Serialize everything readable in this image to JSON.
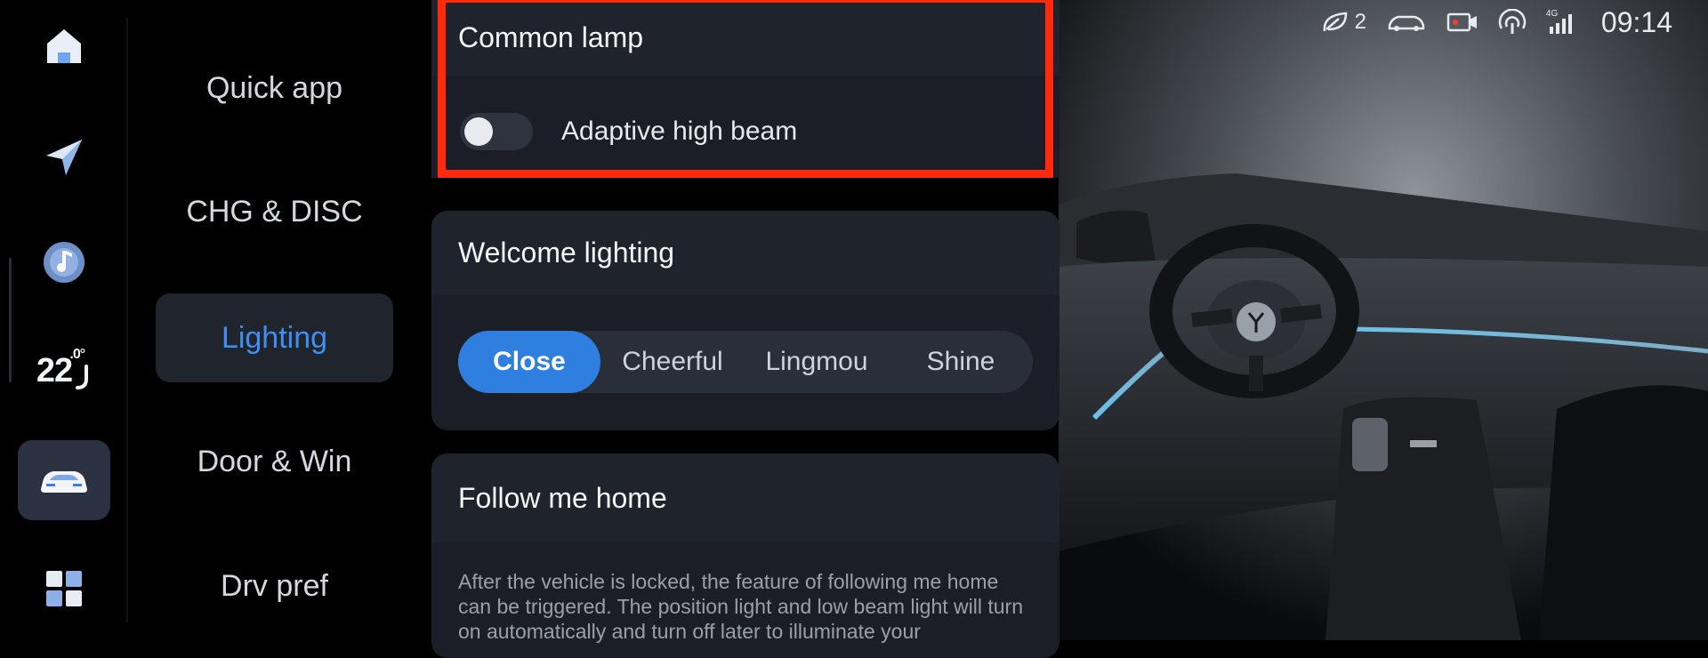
{
  "dock": {
    "items": [
      {
        "icon": "home-icon"
      },
      {
        "icon": "navigation-icon"
      },
      {
        "icon": "music-icon"
      },
      {
        "icon": "climate-seat-icon",
        "temperature": "22",
        "unit": ".0°"
      },
      {
        "icon": "car-icon",
        "active": true
      },
      {
        "icon": "apps-grid-icon"
      }
    ]
  },
  "nav": {
    "items": [
      {
        "label": "Quick app"
      },
      {
        "label": "CHG & DISC"
      },
      {
        "label": "Lighting",
        "active": true
      },
      {
        "label": "Door & Win"
      },
      {
        "label": "Drv pref"
      }
    ]
  },
  "common_lamp": {
    "title": "Common lamp",
    "toggle_label": "Adaptive high beam",
    "toggle_on": false
  },
  "welcome_lighting": {
    "title": "Welcome lighting",
    "options": [
      "Close",
      "Cheerful",
      "Lingmou",
      "Shine"
    ],
    "selected": "Close"
  },
  "follow_me_home": {
    "title": "Follow me home",
    "description": "After the vehicle is locked, the feature of following me home can be triggered. The position light and low beam light will turn on automatically and turn off later to illuminate your"
  },
  "status_bar": {
    "eco_count": "2",
    "network": "4G",
    "time": "09:14"
  },
  "colors": {
    "accent": "#2e7fe0",
    "active_nav_text": "#3f8ff0",
    "highlight_border": "#ff2a0c",
    "panel_bg": "#1b1e26"
  }
}
